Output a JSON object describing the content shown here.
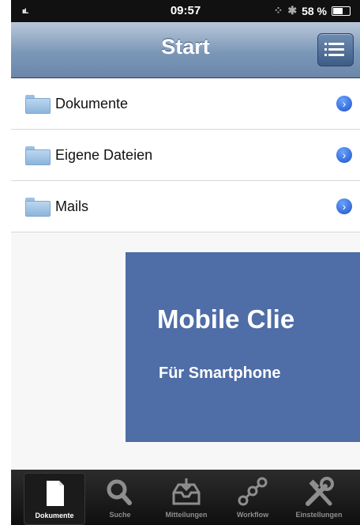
{
  "status_bar": {
    "signal": "ııl..",
    "time": "09:57",
    "sync_glyph": "⁘",
    "bluetooth": "✱",
    "battery": "58 %"
  },
  "nav": {
    "title": "Start"
  },
  "list": {
    "items": [
      {
        "label": "Dokumente",
        "disclosure": "›"
      },
      {
        "label": "Eigene Dateien",
        "disclosure": "›"
      },
      {
        "label": "Mails",
        "disclosure": "›"
      }
    ]
  },
  "promo": {
    "title": "Mobile Clie",
    "subtitle": "Für Smartphone"
  },
  "tabs": [
    {
      "label": "Dokumente",
      "icon": "document-icon",
      "selected": true
    },
    {
      "label": "Suche",
      "icon": "search-icon",
      "selected": false
    },
    {
      "label": "Mitteilungen",
      "icon": "inbox-icon",
      "selected": false
    },
    {
      "label": "Workflow",
      "icon": "workflow-icon",
      "selected": false
    },
    {
      "label": "Einstellungen",
      "icon": "tools-icon",
      "selected": false
    }
  ],
  "colors": {
    "nav_bar": "#7b97b8",
    "promo": "#4f6da6",
    "tab_bar": "#1a1a1a"
  }
}
